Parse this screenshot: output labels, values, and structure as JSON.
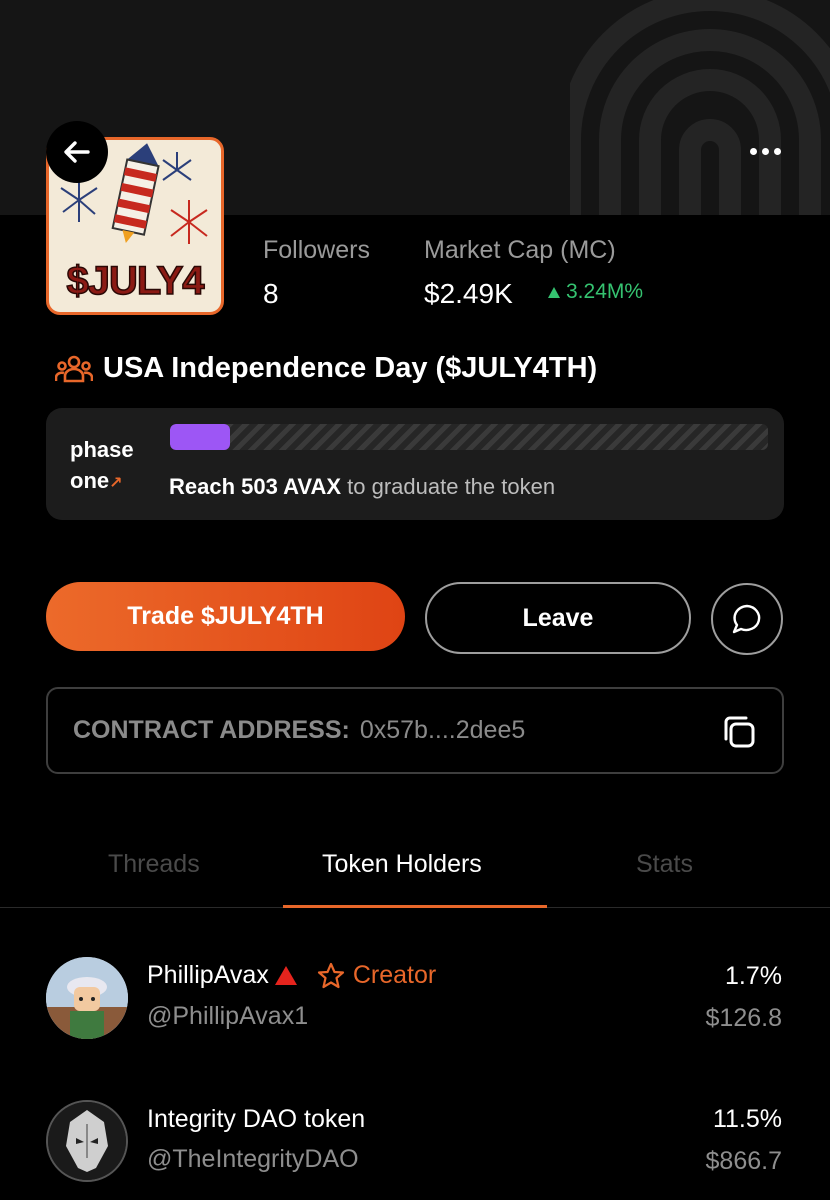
{
  "token": {
    "image_label": "$JULY4",
    "name": "USA Independence Day ($JULY4TH)"
  },
  "stats": {
    "followers_label": "Followers",
    "followers_value": "8",
    "market_cap_label": "Market Cap (MC)",
    "market_cap_value": "$2.49K",
    "market_cap_change": "3.24M%"
  },
  "phase": {
    "label_line1": "phase",
    "label_line2": "one",
    "progress_percent": 10,
    "reach_text": "Reach 503 AVAX",
    "suffix_text": "to graduate the token"
  },
  "actions": {
    "trade_label": "Trade $JULY4TH",
    "leave_label": "Leave"
  },
  "contract": {
    "label": "CONTRACT ADDRESS:",
    "value": "0x57b....2dee5"
  },
  "tabs": [
    {
      "label": "Threads",
      "active": false
    },
    {
      "label": "Token Holders",
      "active": true
    },
    {
      "label": "Stats",
      "active": false
    }
  ],
  "holders": [
    {
      "name": "PhillipAvax",
      "handle": "@PhillipAvax1",
      "badge": "Creator",
      "percent": "1.7%",
      "value": "$126.8"
    },
    {
      "name": "Integrity DAO token",
      "handle": "@TheIntegrityDAO",
      "percent": "11.5%",
      "value": "$866.7"
    }
  ],
  "colors": {
    "accent": "#e8672a",
    "positive": "#35c270",
    "progress": "#9d56f5"
  }
}
